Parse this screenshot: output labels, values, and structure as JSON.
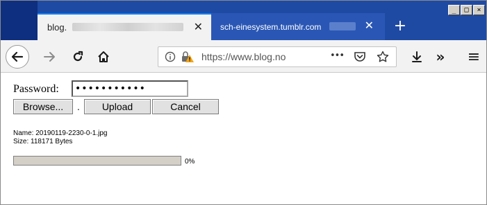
{
  "tabs": [
    {
      "title": "blog.",
      "close": "✕"
    },
    {
      "title": "sch-einesystem.tumblr.com",
      "close": "✕"
    }
  ],
  "newtab_label": "+",
  "window_controls": {
    "minimize": "_",
    "maximize": "□",
    "close": "×"
  },
  "nav": {
    "url": "https://www.blog.no",
    "more": "•••",
    "overflow": "»",
    "menu": "≡"
  },
  "icons": [
    "back-icon",
    "forward-icon",
    "reload-icon",
    "home-icon",
    "info-icon",
    "lock-warning-icon",
    "pocket-icon",
    "star-icon",
    "download-icon"
  ],
  "form": {
    "password_label": "Password:",
    "password_value": "•••••••••••",
    "browse_label": "Browse...",
    "separator": ".",
    "upload_label": "Upload",
    "cancel_label": "Cancel"
  },
  "file": {
    "name_line": "Name: 20190119-2230-0-1.jpg",
    "size_line": "Size: 118171 Bytes"
  },
  "progress": {
    "value": 0,
    "label": "0%"
  },
  "colors": {
    "tabstrip": "#1f4aa3",
    "accent": "#0a84ff",
    "toolbar": "#f2f2f2"
  }
}
